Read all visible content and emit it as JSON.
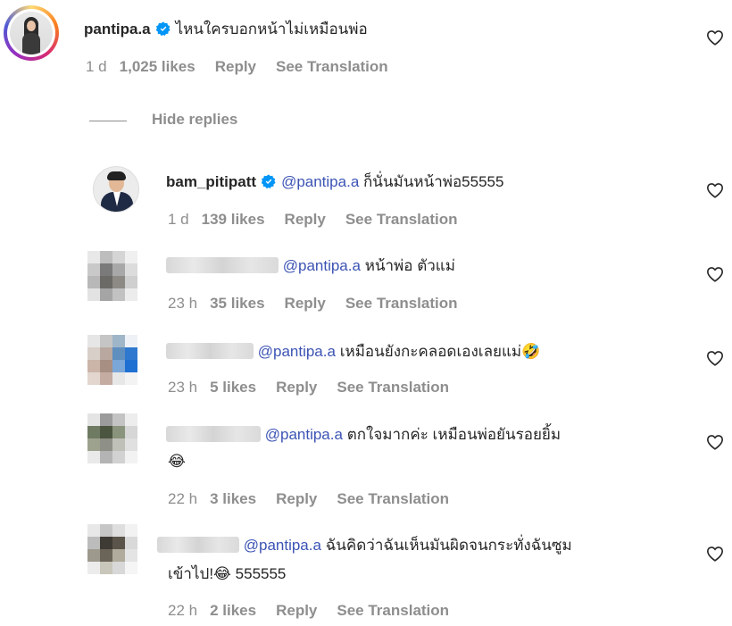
{
  "top_comment": {
    "username": "pantipa.a",
    "text": "ไหนใครบอกหน้าไม่เหมือนพ่อ",
    "time": "1 d",
    "likes": "1,025 likes",
    "reply": "Reply",
    "see_translation": "See Translation"
  },
  "hide_replies": "Hide replies",
  "replies": [
    {
      "username": "bam_pitipatt",
      "mention": "@pantipa.a",
      "text": "ก็นั่นมันหน้าพ่อ55555",
      "time": "1 d",
      "likes": "139 likes",
      "reply": "Reply",
      "see_translation": "See Translation"
    },
    {
      "mention": "@pantipa.a",
      "text": "หน้าพ่อ ตัวแม่",
      "time": "23 h",
      "likes": "35 likes",
      "reply": "Reply",
      "see_translation": "See Translation"
    },
    {
      "mention": "@pantipa.a",
      "text": "เหมือนยังกะคลอดเองเลยแม่",
      "emoji": "🤣",
      "time": "23 h",
      "likes": "5 likes",
      "reply": "Reply",
      "see_translation": "See Translation"
    },
    {
      "mention": "@pantipa.a",
      "text": "ตกใจมากค่ะ เหมือนพ่อยันรอยยิ้ม",
      "emoji": "😂",
      "time": "22 h",
      "likes": "3 likes",
      "reply": "Reply",
      "see_translation": "See Translation"
    },
    {
      "mention": "@pantipa.a",
      "text": "ฉันคิดว่าฉันเห็นมันผิดจนกระทั่งฉันซูม",
      "text2": "เข้าไป!",
      "emoji": "😂",
      "text3": "555555",
      "time": "22 h",
      "likes": "2 likes",
      "reply": "Reply",
      "see_translation": "See Translation"
    }
  ],
  "icons": [
    "verified-badge-icon",
    "heart-icon"
  ],
  "colors": {
    "mention": "#3c54b4",
    "muted": "#8e8e8e",
    "verified": "#0095f6"
  }
}
